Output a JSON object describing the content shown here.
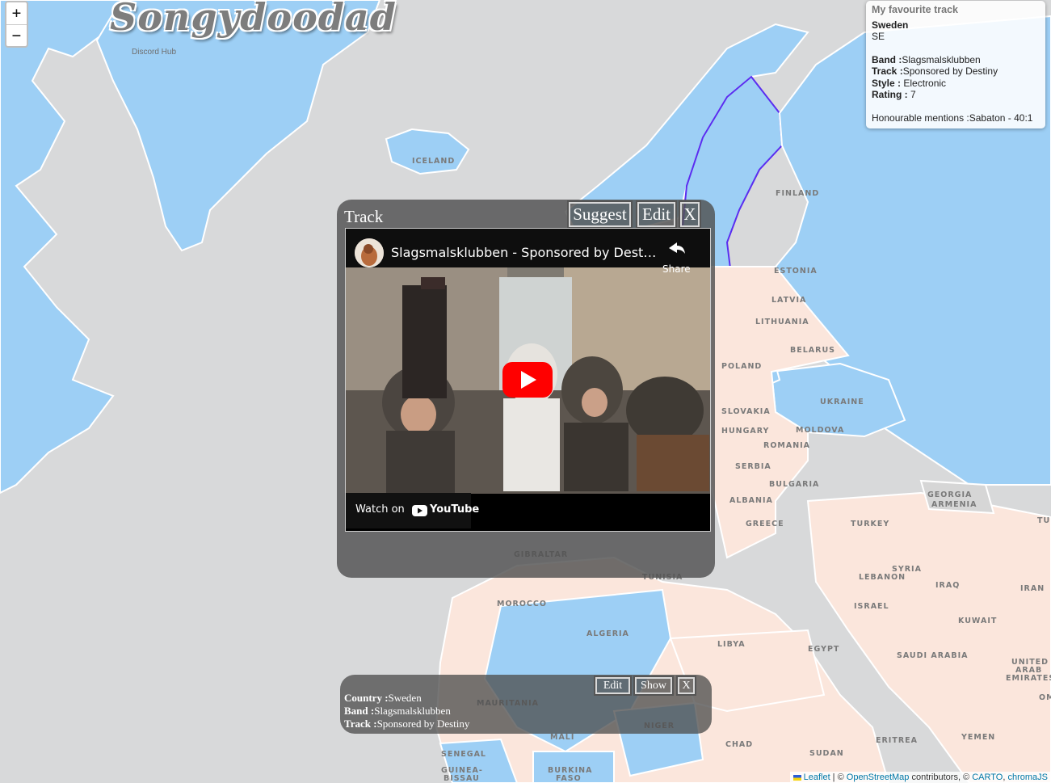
{
  "app": {
    "logo": "Songydoodad",
    "logo_sub": "Discord Hub"
  },
  "zoom": {
    "in": "+",
    "out": "−"
  },
  "map_labels": [
    "ICELAND",
    "FINLAND",
    "ESTONIA",
    "LATVIA",
    "LITHUANIA",
    "BELARUS",
    "POLAND",
    "UKRAINE",
    "SLOVAKIA",
    "HUNGARY",
    "MOLDOVA",
    "ROMANIA",
    "SERBIA",
    "BULGARIA",
    "ALBANIA",
    "GREECE",
    "TURKEY",
    "GEORGIA",
    "ARMENIA",
    "SYRIA",
    "LEBANON",
    "IRAQ",
    "IRAN",
    "ISRAEL",
    "KUWAIT",
    "LIBYA",
    "EGYPT",
    "SAUDI ARABIA",
    "UNITED ARAB EMIRATES",
    "GIBRALTAR",
    "TUNISIA",
    "MOROCCO",
    "ALGERIA",
    "MAURITANIA",
    "MALI",
    "NIGER",
    "CHAD",
    "SUDAN",
    "ERITREA",
    "YEMEN",
    "SENEGAL",
    "GUINEA-BISSAU",
    "BURKINA FASO",
    "OM",
    "TU"
  ],
  "favourite": {
    "title": "My favourite track",
    "country": "Sweden",
    "code": "SE",
    "band_label": "Band :",
    "band": "Slagsmalsklubben",
    "track_label": "Track :",
    "track": "Sponsored by Destiny",
    "style_label": "Style :",
    "style": " Electronic",
    "rating_label": "Rating :",
    "rating": " 7",
    "mentions": "Honourable mentions :Sabaton - 40:1"
  },
  "track_modal": {
    "title": "Track",
    "suggest": "Suggest",
    "edit": "Edit",
    "close": "X",
    "video_title": "Slagsmalsklubben - Sponsored by Destiny (...",
    "share": "Share",
    "watch_on": "Watch on",
    "youtube": "YouTube"
  },
  "info_panel": {
    "edit": "Edit",
    "show": "Show",
    "close": "X",
    "country_label": "Country :",
    "country": "Sweden",
    "band_label": "Band :",
    "band": "Slagsmalsklubben",
    "track_label": "Track :",
    "track": "Sponsored by Destiny"
  },
  "attribution": {
    "leaflet": "Leaflet",
    "sep1": " | © ",
    "osm": "OpenStreetMap",
    "contrib": " contributors, © ",
    "carto": "CARTO",
    "sep2": ", ",
    "chroma": "chromaJS"
  },
  "colors": {
    "water": "#d8d9da",
    "land_blue": "#9dcff5",
    "land_peach": "#fbe6dc",
    "land_grey": "#d6d6d6",
    "sweden_outline": "#5a2df0"
  }
}
